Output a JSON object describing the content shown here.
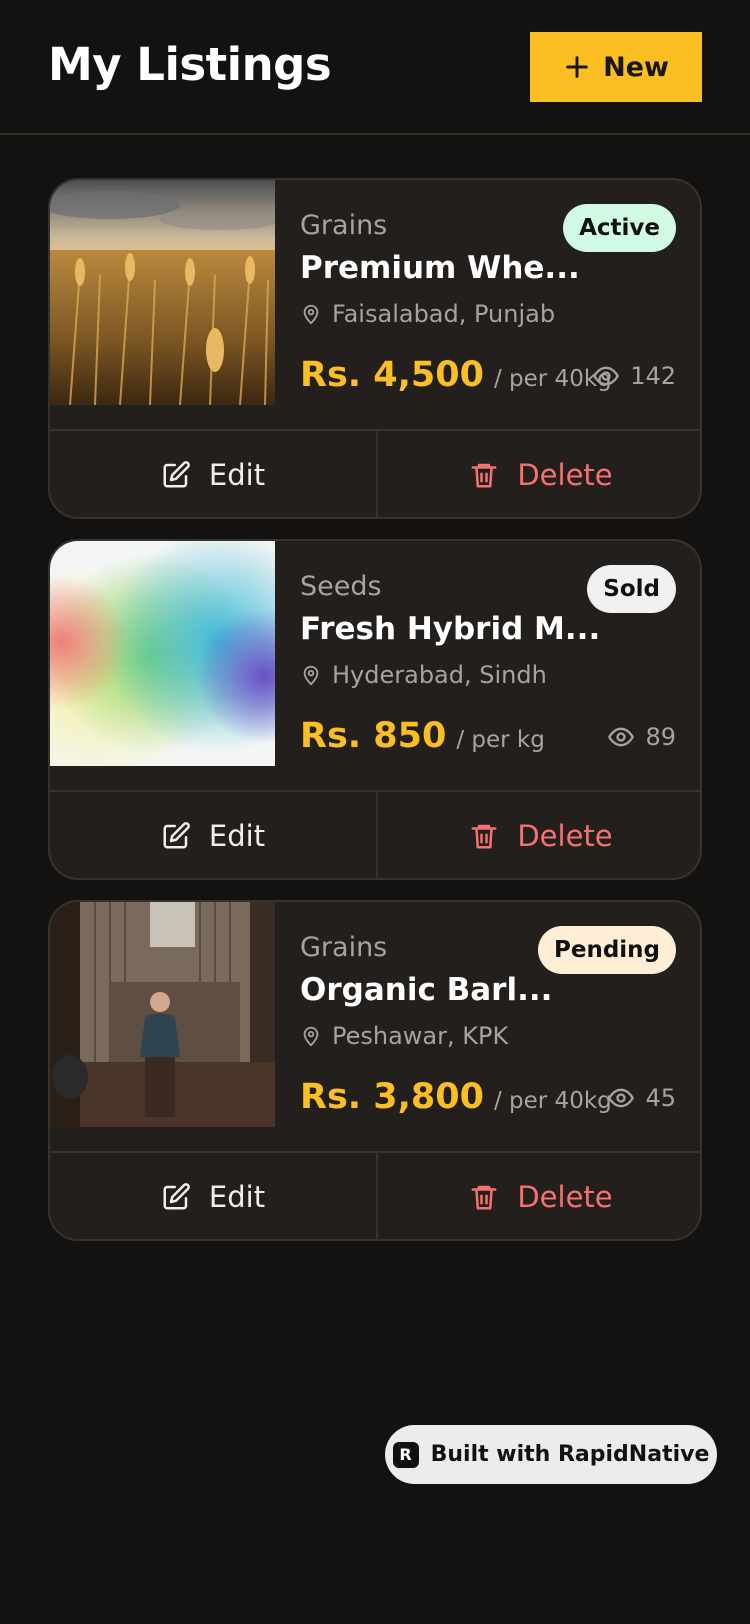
{
  "header": {
    "title": "My Listings",
    "new_label": "New"
  },
  "listings": [
    {
      "category": "Grains",
      "name": "Premium Whe...",
      "location": "Faisalabad, Punjab",
      "price": "Rs. 4,500",
      "unit": "/ per 40kg",
      "views": "142",
      "status": "Active",
      "status_bg": "#d1fae5",
      "edit_label": "Edit",
      "delete_label": "Delete"
    },
    {
      "category": "Seeds",
      "name": "Fresh Hybrid M...",
      "location": "Hyderabad, Sindh",
      "price": "Rs. 850",
      "unit": "/ per kg",
      "views": "89",
      "status": "Sold",
      "status_bg": "#f1f1f1",
      "edit_label": "Edit",
      "delete_label": "Delete"
    },
    {
      "category": "Grains",
      "name": "Organic Barl...",
      "location": "Peshawar, KPK",
      "price": "Rs. 3,800",
      "unit": "/ per 40kg",
      "views": "45",
      "status": "Pending",
      "status_bg": "#ffedd5",
      "edit_label": "Edit",
      "delete_label": "Delete"
    }
  ],
  "colors": {
    "accent": "#fbbf24",
    "danger": "#f87171",
    "background": "#141210",
    "card": "#221f1c"
  },
  "footer": {
    "built_label": "Built with RapidNative"
  }
}
